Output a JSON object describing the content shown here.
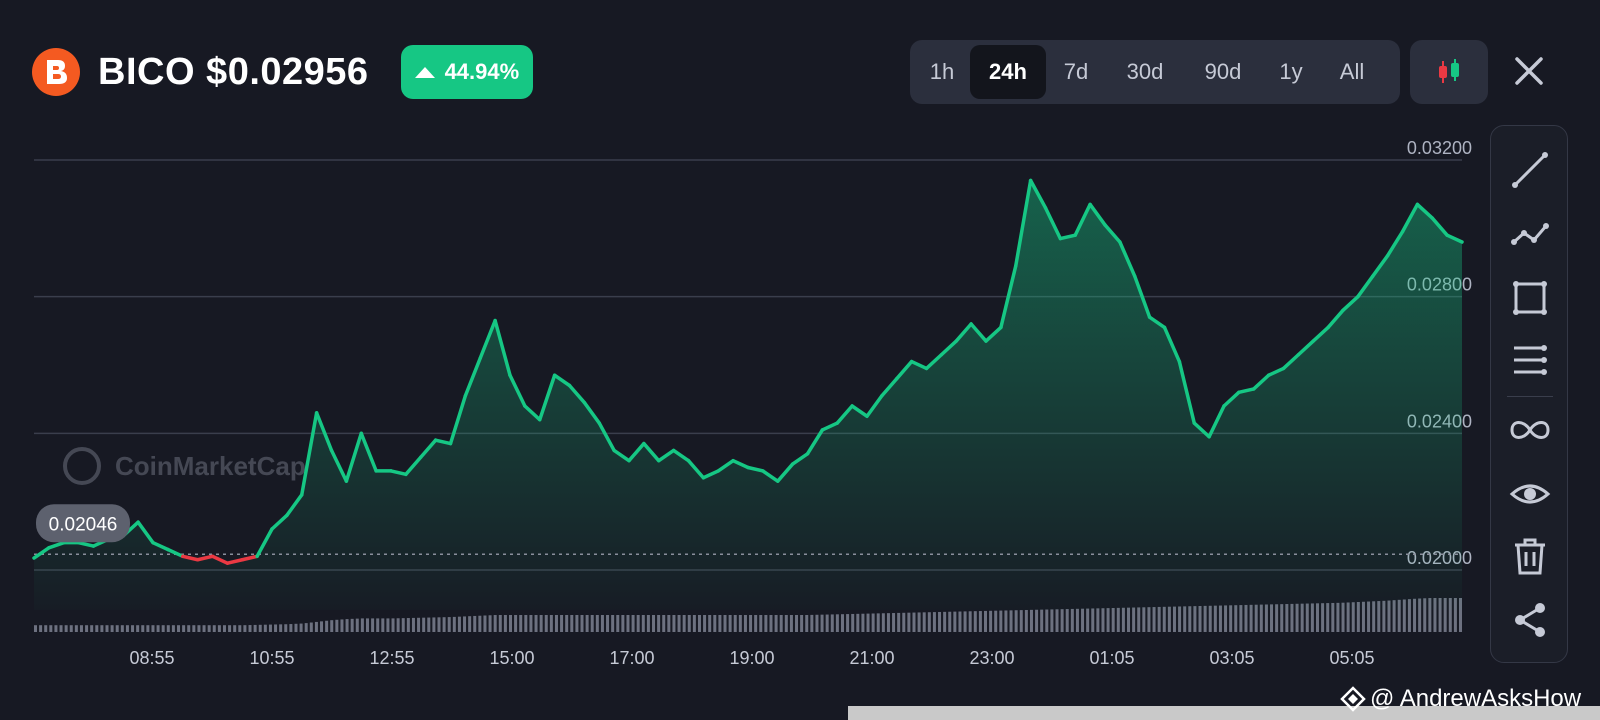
{
  "header": {
    "coin_symbol": "BICO",
    "price": "$0.02956",
    "title_text": "BICO $0.02956",
    "change_percent": "44.94%",
    "logo_icon": "biconomy-logo-icon"
  },
  "colors": {
    "background": "#171923",
    "up": "#16c784",
    "down": "#ea3943",
    "logo": "#f45a21",
    "gridline": "#3a3e4c"
  },
  "range_tabs": [
    {
      "label": "1h",
      "active": false
    },
    {
      "label": "24h",
      "active": true
    },
    {
      "label": "7d",
      "active": false
    },
    {
      "label": "30d",
      "active": false
    },
    {
      "label": "90d",
      "active": false
    },
    {
      "label": "1y",
      "active": false
    },
    {
      "label": "All",
      "active": false
    }
  ],
  "toolbar": {
    "candlestick_icon": "candlestick-icon",
    "close_icon": "close-icon",
    "tools": [
      "trend-line-icon",
      "polyline-icon",
      "rectangle-icon",
      "horizontal-lines-icon",
      "infinity-icon",
      "eye-icon",
      "trash-icon",
      "share-icon"
    ]
  },
  "watermarks": {
    "chart": "CoinMarketCap",
    "footer": "@ AndrewAsksHow"
  },
  "chart_data": {
    "type": "area",
    "x_tick_labels": [
      "08:55",
      "10:55",
      "12:55",
      "15:00",
      "17:00",
      "19:00",
      "21:00",
      "23:00",
      "01:05",
      "03:05",
      "05:05"
    ],
    "y_tick_labels": [
      "0.03200",
      "0.02800",
      "0.02400",
      "0.02000"
    ],
    "ylim": [
      0.0195,
      0.0325
    ],
    "reference_price": 0.02046,
    "reference_label": "0.02046",
    "grid": true,
    "hours": [
      0,
      0.25,
      0.5,
      0.75,
      1,
      1.25,
      1.5,
      1.75,
      2,
      2.25,
      2.5,
      2.75,
      3,
      3.25,
      3.5,
      3.75,
      4,
      4.25,
      4.5,
      4.75,
      5,
      5.25,
      5.5,
      5.75,
      6,
      6.25,
      6.5,
      6.75,
      7,
      7.25,
      7.5,
      7.75,
      8,
      8.25,
      8.5,
      8.75,
      9,
      9.25,
      9.5,
      9.75,
      10,
      10.25,
      10.5,
      10.75,
      11,
      11.25,
      11.5,
      11.75,
      12,
      12.25,
      12.5,
      12.75,
      13,
      13.25,
      13.5,
      13.75,
      14,
      14.25,
      14.5,
      14.75,
      15,
      15.25,
      15.5,
      15.75,
      16,
      16.25,
      16.5,
      16.75,
      17,
      17.25,
      17.5,
      17.75,
      18,
      18.25,
      18.5,
      18.75,
      19,
      19.25,
      19.5,
      19.75,
      20,
      20.25,
      20.5,
      20.75,
      21,
      21.25,
      21.5,
      21.75,
      22,
      22.25,
      22.5,
      22.75,
      23,
      23.25,
      23.5,
      23.75,
      24
    ],
    "prices": [
      0.02035,
      0.02065,
      0.0208,
      0.0208,
      0.0207,
      0.0209,
      0.021,
      0.0214,
      0.0208,
      0.0206,
      0.0204,
      0.0203,
      0.0204,
      0.0202,
      0.0203,
      0.0204,
      0.0212,
      0.0216,
      0.0222,
      0.0246,
      0.0235,
      0.0226,
      0.024,
      0.0229,
      0.0229,
      0.0228,
      0.0233,
      0.0238,
      0.0237,
      0.0251,
      0.0262,
      0.0273,
      0.0257,
      0.0248,
      0.0244,
      0.0257,
      0.0254,
      0.0249,
      0.0243,
      0.0235,
      0.0232,
      0.0237,
      0.0232,
      0.0235,
      0.0232,
      0.0227,
      0.0229,
      0.0232,
      0.023,
      0.0229,
      0.0226,
      0.0231,
      0.0234,
      0.0241,
      0.0243,
      0.0248,
      0.0245,
      0.0251,
      0.0256,
      0.0261,
      0.0259,
      0.0263,
      0.0267,
      0.0272,
      0.0267,
      0.0271,
      0.0289,
      0.0314,
      0.0306,
      0.0297,
      0.0298,
      0.0307,
      0.0301,
      0.0296,
      0.0286,
      0.0274,
      0.0271,
      0.0261,
      0.0243,
      0.0239,
      0.0248,
      0.0252,
      0.0253,
      0.0257,
      0.0259,
      0.0263,
      0.0267,
      0.0271,
      0.0276,
      0.028,
      0.0286,
      0.0292,
      0.0299,
      0.0307,
      0.0303,
      0.0298,
      0.0296
    ],
    "volume": [
      0.2,
      0.2,
      0.2,
      0.2,
      0.2,
      0.2,
      0.2,
      0.2,
      0.2,
      0.2,
      0.2,
      0.2,
      0.2,
      0.2,
      0.2,
      0.21,
      0.22,
      0.23,
      0.25,
      0.3,
      0.35,
      0.38,
      0.4,
      0.4,
      0.4,
      0.41,
      0.42,
      0.43,
      0.44,
      0.46,
      0.48,
      0.5,
      0.5,
      0.5,
      0.5,
      0.5,
      0.5,
      0.5,
      0.5,
      0.5,
      0.5,
      0.5,
      0.5,
      0.5,
      0.5,
      0.5,
      0.5,
      0.5,
      0.5,
      0.5,
      0.5,
      0.5,
      0.5,
      0.51,
      0.52,
      0.53,
      0.54,
      0.55,
      0.56,
      0.57,
      0.58,
      0.59,
      0.6,
      0.61,
      0.62,
      0.63,
      0.64,
      0.65,
      0.66,
      0.67,
      0.68,
      0.69,
      0.7,
      0.71,
      0.72,
      0.73,
      0.74,
      0.75,
      0.76,
      0.77,
      0.78,
      0.79,
      0.8,
      0.81,
      0.82,
      0.83,
      0.84,
      0.85,
      0.86,
      0.88,
      0.9,
      0.92,
      0.95,
      0.98,
      1,
      1,
      1
    ]
  }
}
